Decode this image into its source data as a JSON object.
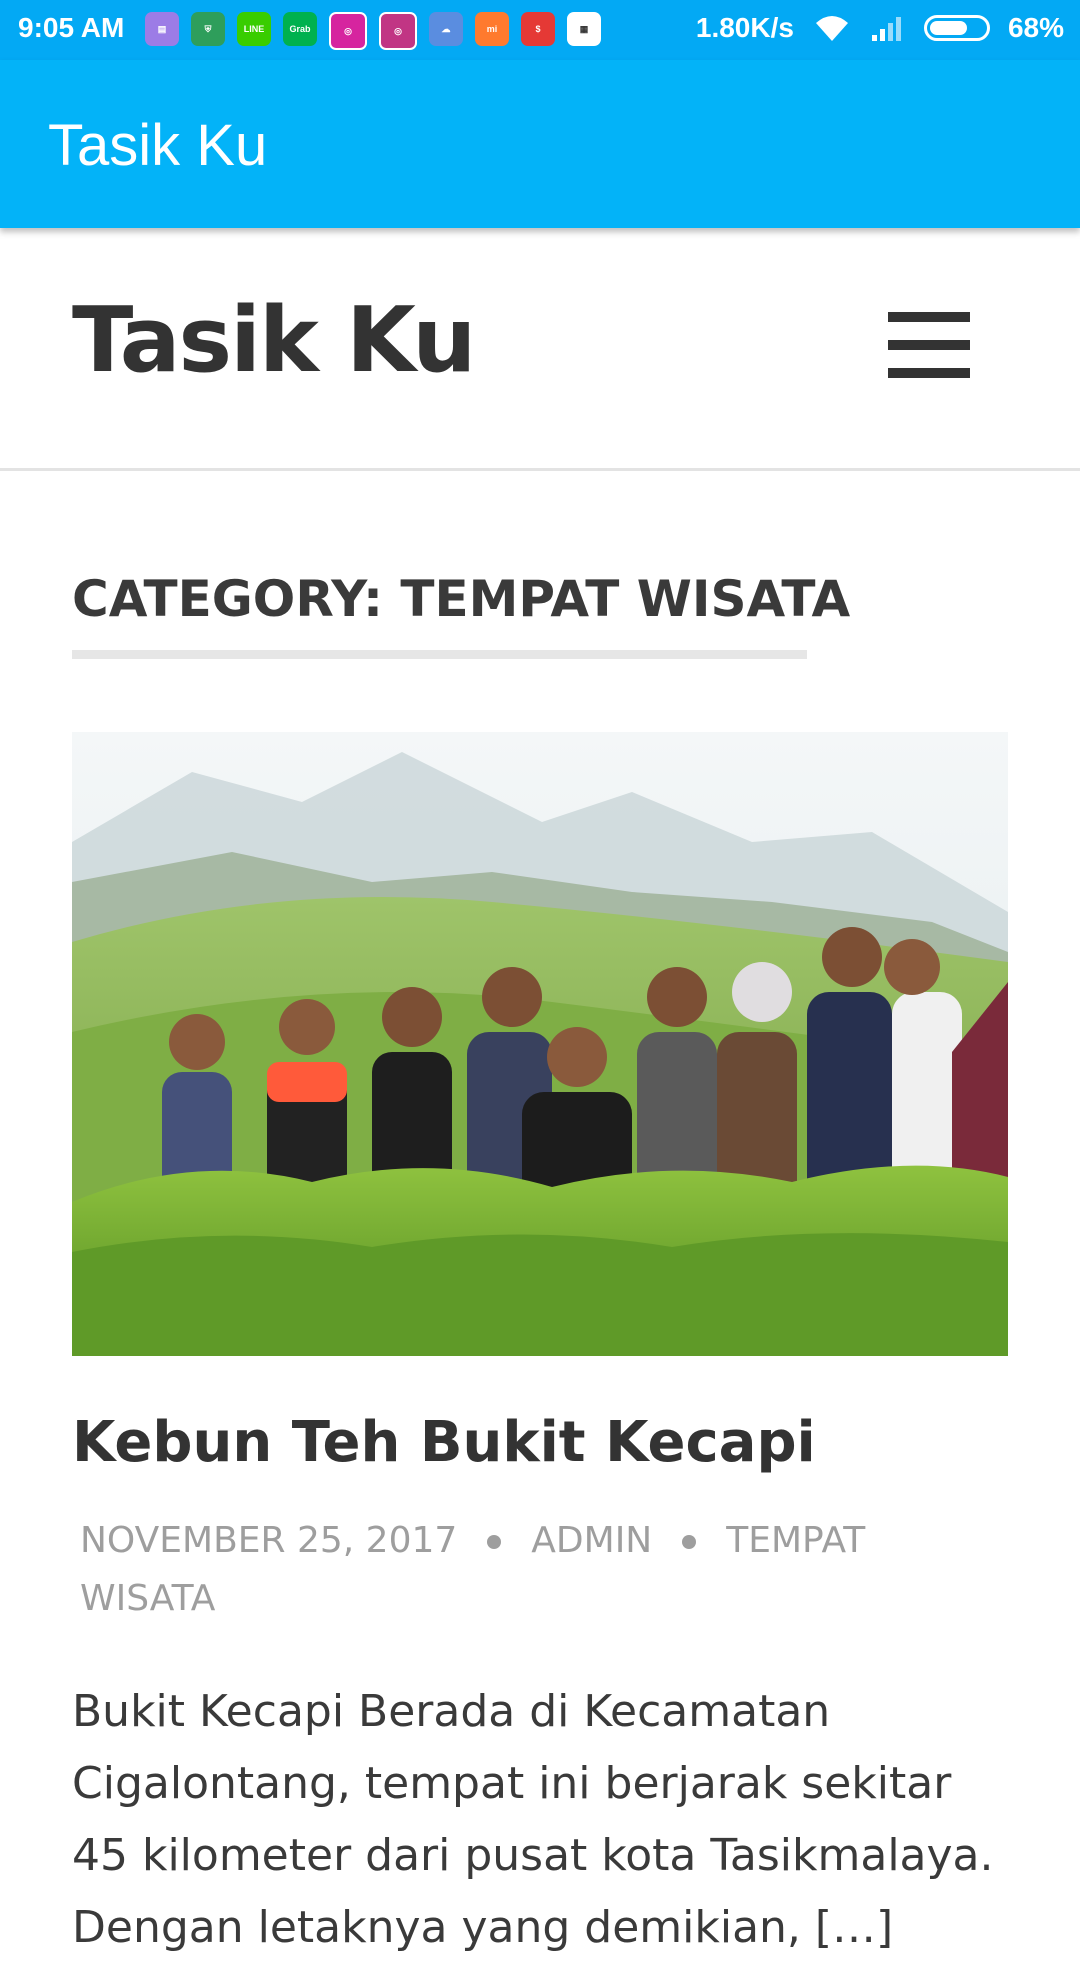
{
  "status_bar": {
    "time": "9:05 AM",
    "network_speed": "1.80K/s",
    "battery_percent": "68%",
    "battery_level": 0.68,
    "icons": [
      "notes-icon",
      "shield-icon",
      "line-app-icon",
      "grab-driver-icon",
      "instagram-icon",
      "instagram-icon",
      "cloud-icon",
      "mi-app-icon",
      "money-locker-icon",
      "bbm-icon",
      "wifi-icon",
      "signal-icon",
      "battery-icon"
    ]
  },
  "app_bar": {
    "title": "Tasik Ku",
    "color": "#03b3f8"
  },
  "site_header": {
    "site_title": "Tasik Ku",
    "menu_icon": "hamburger-menu-icon"
  },
  "archive": {
    "heading": "CATEGORY: TEMPAT WISATA"
  },
  "post": {
    "title": "Kebun Teh Bukit Kecapi",
    "date": "NOVEMBER 25, 2017",
    "author": "ADMIN",
    "category": "TEMPAT WISATA",
    "excerpt": "Bukit Kecapi Berada di Kecamatan Cigalontang, tempat ini berjarak sekitar 45 kilometer dari pusat kota Tasikmalaya. Dengan letaknya yang demikian, […]"
  },
  "colors": {
    "status_bar": "#03a9f4",
    "text_dark": "#333333",
    "meta_gray": "#9e9e9e"
  }
}
